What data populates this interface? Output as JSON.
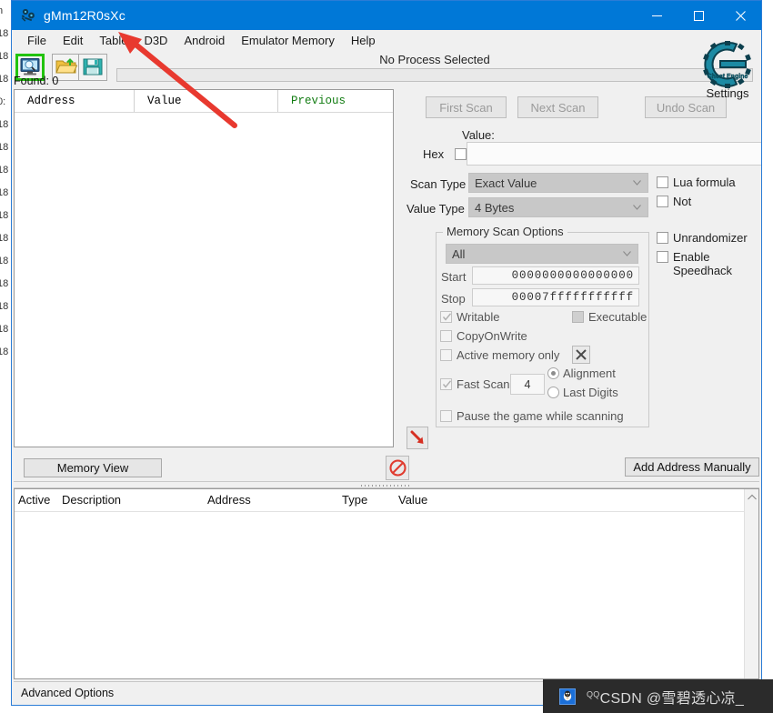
{
  "window": {
    "title": "gMm12R0sXc",
    "icon": "cheat-engine-icon",
    "minimize": "–",
    "maximize": "☐",
    "close": "✕"
  },
  "menu": {
    "items": [
      {
        "label": "File"
      },
      {
        "label": "Edit"
      },
      {
        "label": "Table"
      },
      {
        "label": "D3D"
      },
      {
        "label": "Android"
      },
      {
        "label": "Emulator Memory"
      },
      {
        "label": "Help"
      }
    ]
  },
  "toolbar": {
    "open_process_icon": "monitor-magnifier-icon",
    "open_file_icon": "open-folder-icon",
    "save_file_icon": "floppy-save-icon",
    "process_label": "No Process Selected",
    "found_label": "Found: 0"
  },
  "results": {
    "columns": [
      "Address",
      "Value",
      "Previous"
    ],
    "rows": [],
    "previous_color": "#127c12"
  },
  "scan": {
    "first_scan": "First Scan",
    "next_scan": "Next Scan",
    "undo_scan": "Undo Scan",
    "settings_label": "Settings",
    "settings_icon": "cheat-engine-logo-icon",
    "value_label": "Value:",
    "value_text": "",
    "hex_label": "Hex",
    "hex_checked": false,
    "scan_type_label": "Scan Type",
    "scan_type_value": "Exact Value",
    "value_type_label": "Value Type",
    "value_type_value": "4 Bytes",
    "lua_formula_label": "Lua formula",
    "lua_formula_checked": false,
    "not_label": "Not",
    "not_checked": false,
    "unrandomizer_label": "Unrandomizer",
    "unrandomizer_checked": false,
    "speedhack_label": "Enable Speedhack",
    "speedhack_checked": false
  },
  "memory_scan_options": {
    "group_title": "Memory Scan Options",
    "region_value": "All",
    "start_label": "Start",
    "start_value": "0000000000000000",
    "stop_label": "Stop",
    "stop_value": "00007fffffffffff",
    "writable_label": "Writable",
    "writable_checked": true,
    "executable_label": "Executable",
    "executable_checked": false,
    "copyonwrite_label": "CopyOnWrite",
    "copyonwrite_checked": false,
    "active_memory_label": "Active memory only",
    "active_memory_checked": false,
    "clear_button_icon": "x-close-icon",
    "fast_scan_label": "Fast Scan",
    "fast_scan_checked": true,
    "fast_scan_value": "4",
    "alignment_label": "Alignment",
    "alignment_selected": true,
    "last_digits_label": "Last Digits",
    "last_digits_selected": false,
    "pause_label": "Pause the game while scanning",
    "pause_checked": false
  },
  "midbar": {
    "memory_view": "Memory View",
    "add_address_manually": "Add Address Manually",
    "deactivate_icon": "no-entry-icon",
    "move_down_icon": "red-arrow-down-right-icon"
  },
  "cheat_table": {
    "columns": [
      "Active",
      "Description",
      "Address",
      "Type",
      "Value"
    ],
    "rows": [],
    "scroll_up_icon": "chevron-up-icon"
  },
  "statusbar": {
    "advanced_options": "Advanced Options"
  },
  "annotations": {
    "arrow_color": "#e8392f",
    "pointer_arrow_target": "Table / D3D menu"
  },
  "watermark": {
    "logo_icon": "qq-penguin-icon",
    "superscript": "QQ",
    "text": "CSDN @雪碧透心凉_",
    "background": "#2b2b2b"
  },
  "background_window": {
    "left_edge_fragments": [
      "n",
      "18",
      "18",
      "18",
      "0:",
      "18",
      "18",
      "18",
      "18",
      "18",
      "18",
      "18",
      "18",
      "18",
      "18",
      "18"
    ]
  }
}
